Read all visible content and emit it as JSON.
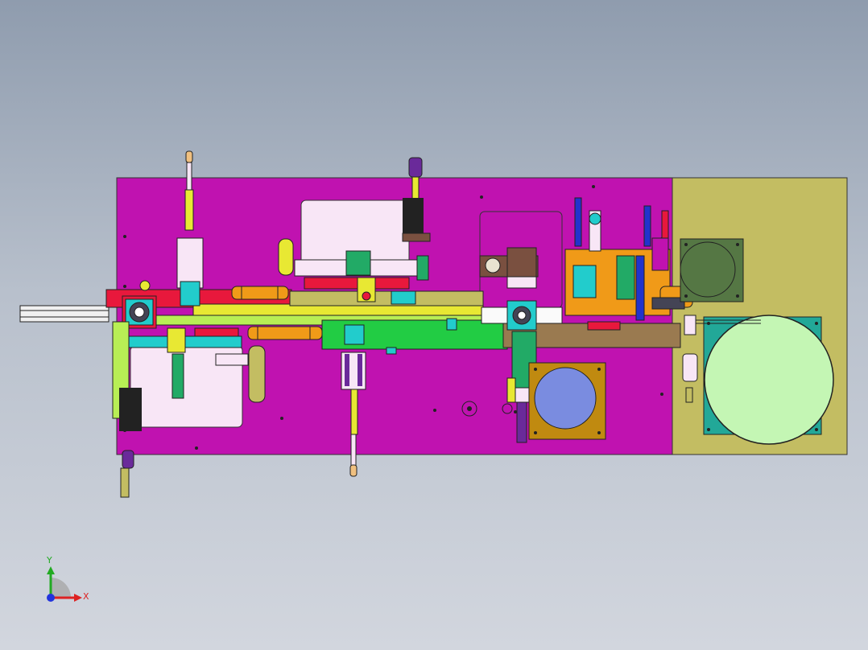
{
  "viewport": {
    "background_top": "#8f9cae",
    "background_bottom": "#d2d6de"
  },
  "colors": {
    "base_plate": "#c012b0",
    "side_plate": "#c3bd62",
    "pale_pink": "#f8e6f6",
    "red": "#e8183c",
    "green": "#22cc44",
    "lime": "#b8ee55",
    "yellow": "#e8e833",
    "orange": "#f09a18",
    "cyan": "#22cccc",
    "blue": "#2233cc",
    "brown": "#7a5040",
    "teal": "#22a898",
    "motor_green": "#557744",
    "disc_light": "#c4f6b4",
    "disc_blue": "#7a8ce0",
    "plate_gold": "#c08a10",
    "purple": "#6a2a9a",
    "olive": "#8a7a44"
  },
  "triad": {
    "x_label": "X",
    "y_label": "Y",
    "x_color": "#dd2222",
    "y_color": "#22aa22",
    "z_color": "#2233dd"
  }
}
